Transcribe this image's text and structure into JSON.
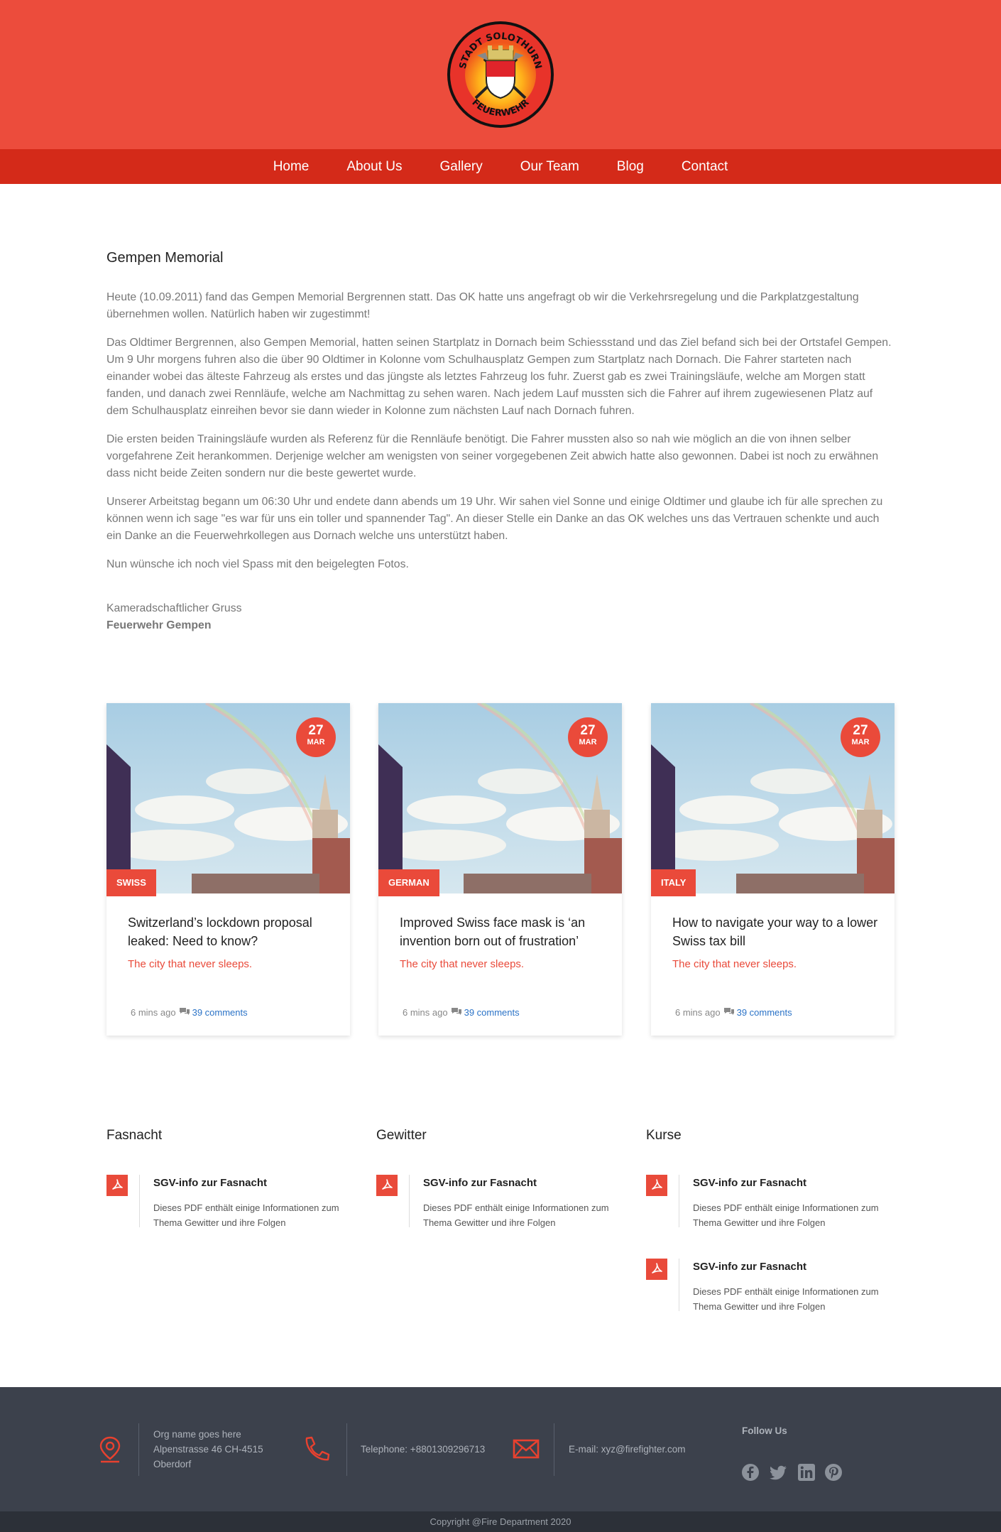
{
  "header": {
    "logo_top_text": "STADT SOLOTHURN",
    "logo_bottom_text": "FEUERWEHR",
    "colors": {
      "band": "#ec4c3c",
      "nav": "#d42a19"
    }
  },
  "nav": {
    "items": [
      {
        "label": "Home"
      },
      {
        "label": "About Us"
      },
      {
        "label": "Gallery"
      },
      {
        "label": "Our Team"
      },
      {
        "label": "Blog"
      },
      {
        "label": "Contact"
      }
    ]
  },
  "article": {
    "title": "Gempen Memorial",
    "paragraphs": [
      "Heute (10.09.2011) fand das Gempen Memorial Bergrennen statt. Das OK hatte uns angefragt ob wir die Verkehrsregelung und die Parkplatzgestaltung übernehmen wollen. Natürlich haben wir zugestimmt!",
      "Das Oldtimer Bergrennen, also Gempen Memorial, hatten seinen Startplatz in Dornach beim Schiessstand und das Ziel befand sich bei der Ortstafel Gempen. Um 9 Uhr morgens fuhren also die über 90 Oldtimer in Kolonne vom Schulhausplatz Gempen zum Startplatz nach Dornach. Die Fahrer starteten nach einander wobei das älteste Fahrzeug als erstes und das jüngste als letztes Fahrzeug los fuhr. Zuerst gab es zwei Trainingsläufe, welche am Morgen statt fanden, und danach zwei Rennläufe, welche am Nachmittag zu sehen waren. Nach jedem Lauf mussten sich die Fahrer auf ihrem zugewiesenen Platz auf dem Schulhausplatz einreihen bevor sie dann wieder in Kolonne zum nächsten Lauf nach Dornach fuhren.",
      "Die ersten beiden Trainingsläufe wurden als Referenz für die Rennläufe benötigt. Die Fahrer mussten also so nah wie möglich an die von ihnen selber vorgefahrene Zeit herankommen. Derjenige welcher am wenigsten von seiner vorgegebenen Zeit abwich hatte also gewonnen. Dabei ist noch zu erwähnen dass nicht beide Zeiten sondern nur die beste gewertet wurde.",
      "Unserer Arbeitstag begann um 06:30 Uhr und endete dann abends um 19 Uhr. Wir sahen viel Sonne und einige Oldtimer und glaube ich für alle sprechen zu können wenn ich sage \"es war für uns ein toller und spannender Tag\". An dieser Stelle ein Danke an das OK welches uns das Vertrauen schenkte und auch ein Danke an die Feuerwehrkollegen aus Dornach welche uns unterstützt haben.",
      "Nun wünsche ich noch viel Spass mit den beigelegten Fotos."
    ],
    "greeting": "Kameradschaftlicher Gruss",
    "signature": "Feuerwehr Gempen"
  },
  "cards": [
    {
      "day": "27",
      "month": "MAR",
      "category": "SWISS",
      "title": "Switzerland’s lockdown proposal leaked: Need to know?",
      "subtitle": "The city that never sleeps.",
      "time": "6 mins ago",
      "comments": "39 comments"
    },
    {
      "day": "27",
      "month": "MAR",
      "category": "GERMAN",
      "title": "Improved Swiss face mask is ‘an invention born out of frustration’",
      "subtitle": "The city that never sleeps.",
      "time": "6 mins ago",
      "comments": "39 comments"
    },
    {
      "day": "27",
      "month": "MAR",
      "category": "ITALY",
      "title": "How to navigate your way to a lower Swiss tax bill",
      "subtitle": "The city that never sleeps.",
      "time": "6 mins ago",
      "comments": "39 comments"
    }
  ],
  "downloads": [
    {
      "heading": "Fasnacht",
      "items": [
        {
          "title": "SGV-info zur Fasnacht",
          "desc": "Dieses PDF enthält einige Informationen zum Thema Gewitter und ihre Folgen"
        }
      ]
    },
    {
      "heading": "Gewitter",
      "items": [
        {
          "title": "SGV-info zur Fasnacht",
          "desc": "Dieses PDF enthält einige Informationen zum Thema Gewitter und ihre Folgen"
        }
      ]
    },
    {
      "heading": "Kurse",
      "items": [
        {
          "title": "SGV-info zur Fasnacht",
          "desc": "Dieses PDF enthält einige Informationen zum Thema Gewitter und ihre Folgen"
        },
        {
          "title": "SGV-info zur Fasnacht",
          "desc": "Dieses PDF enthält einige Informationen zum Thema Gewitter und ihre Folgen"
        }
      ]
    }
  ],
  "footer": {
    "address": [
      "Org name goes here",
      "Alpenstrasse 46 CH-4515",
      "Oberdorf"
    ],
    "phone": "Telephone: +8801309296713",
    "email": "E-mail: xyz@firefighter.com",
    "follow_title": "Follow Us",
    "social": [
      "facebook-icon",
      "twitter-icon",
      "linkedin-icon",
      "pinterest-icon"
    ],
    "copyright": "Copyright @Fire Department 2020"
  },
  "colors": {
    "accent": "#ea4a3a",
    "link": "#2b73c7",
    "footer": "#3c414c"
  }
}
